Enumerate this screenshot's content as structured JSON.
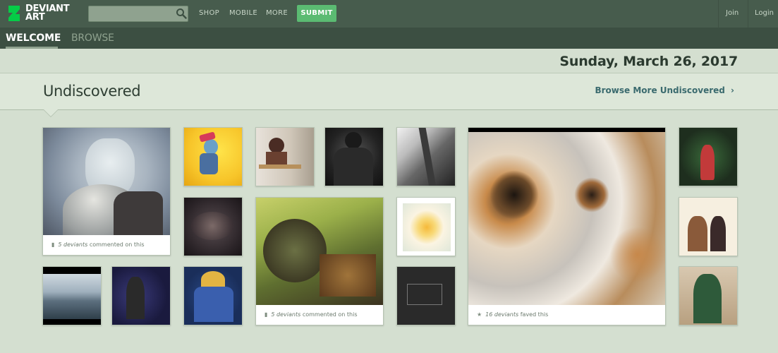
{
  "header": {
    "logo_line1": "DEVIANT",
    "logo_line2": "ART",
    "search": {
      "placeholder": "",
      "value": ""
    },
    "nav": [
      {
        "label": "SHOP"
      },
      {
        "label": "MOBILE"
      },
      {
        "label": "MORE"
      }
    ],
    "submit_label": "SUBMIT",
    "join_label": "Join",
    "login_label": "Login"
  },
  "subnav": {
    "tabs": [
      {
        "label": "WELCOME",
        "active": true
      },
      {
        "label": "BROWSE",
        "active": false
      }
    ]
  },
  "date": "Sunday, March 26, 2017",
  "section": {
    "title": "Undiscovered",
    "browse_more": "Browse More Undiscovered",
    "chevron": "›"
  },
  "thumbs": {
    "large1": {
      "count": "5 deviants",
      "suffix": "commented on this",
      "icon": "comment-icon"
    },
    "large2": {
      "count": "5 deviants",
      "suffix": "commented on this",
      "icon": "comment-icon"
    },
    "large3": {
      "count": "16 deviants",
      "suffix": "faved this",
      "icon": "star-icon"
    }
  },
  "colors": {
    "topbar": "#475c4d",
    "subnav": "#3c4f42",
    "submit": "#5bbb72",
    "background": "#d4dfd0",
    "logo_green": "#05cc47"
  }
}
